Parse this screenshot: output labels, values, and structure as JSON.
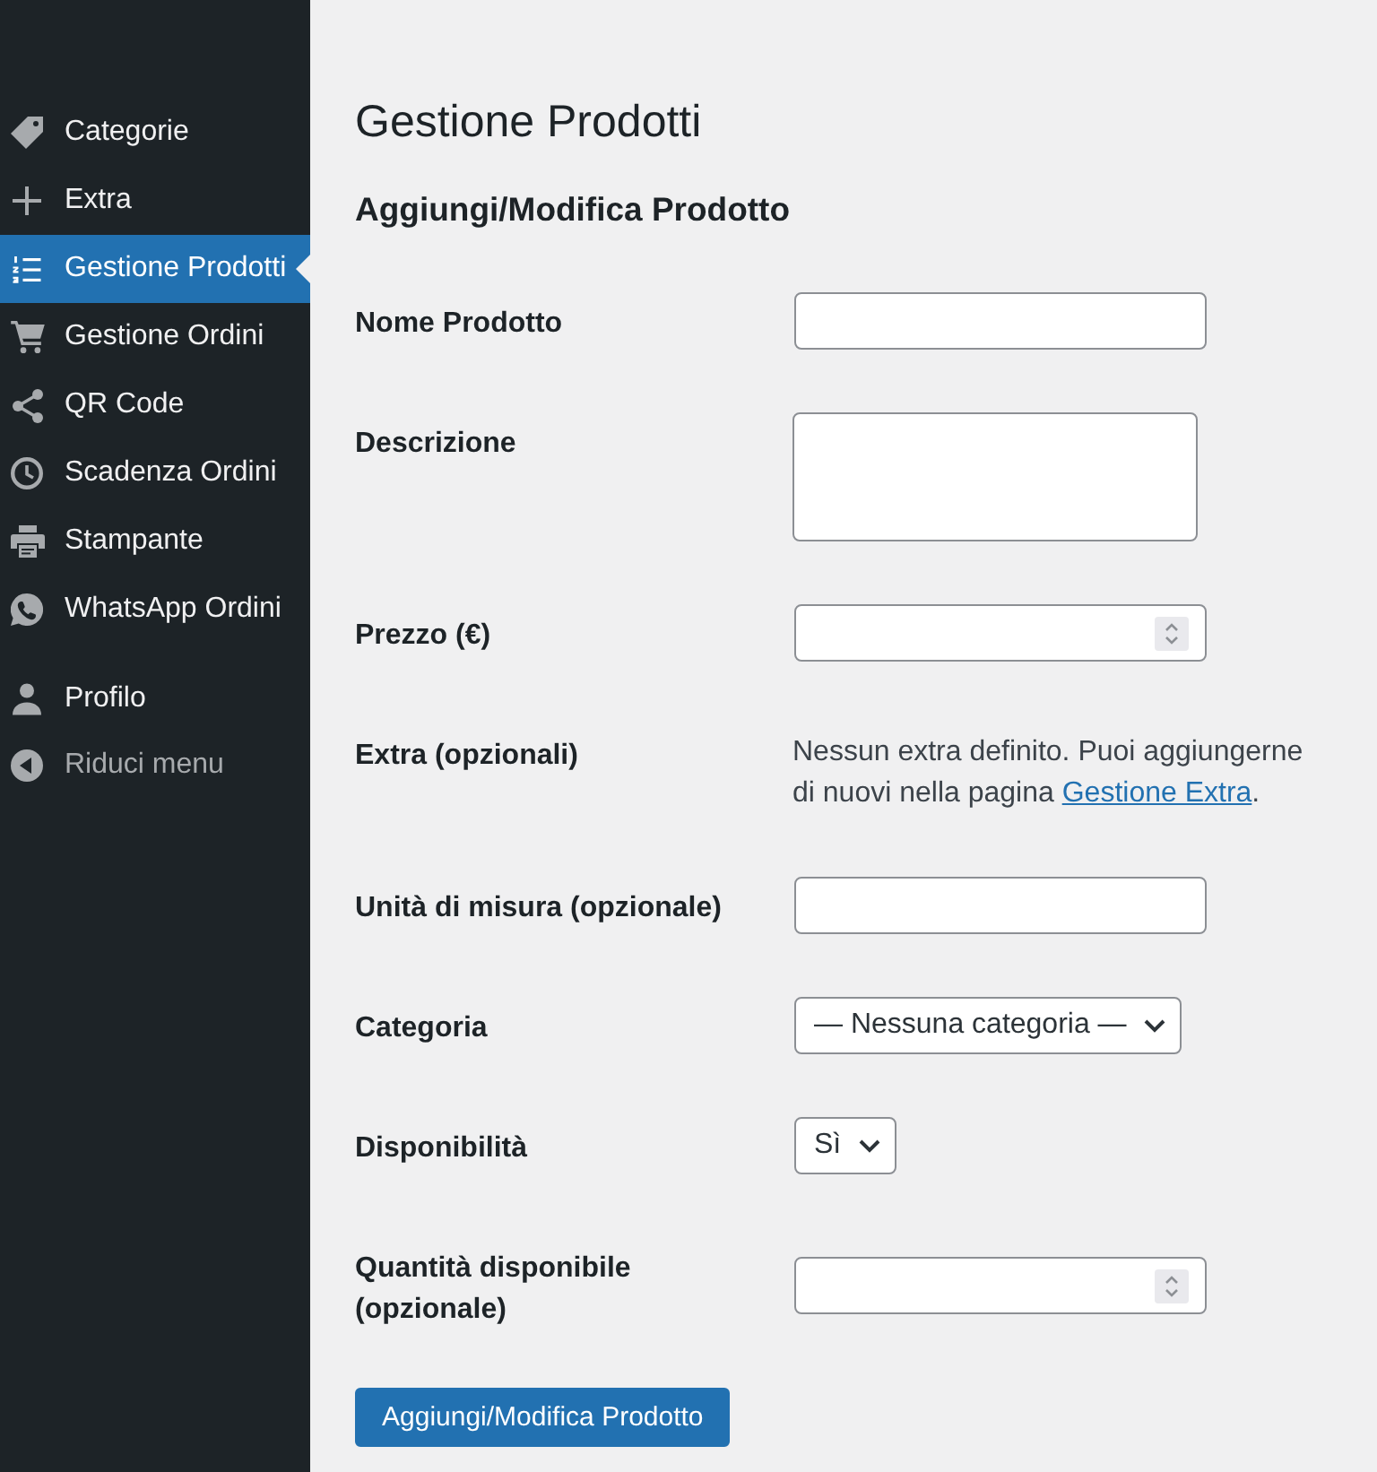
{
  "sidebar": {
    "items": [
      {
        "label": "Categorie",
        "selected": false
      },
      {
        "label": "Extra",
        "selected": false
      },
      {
        "label": "Gestione Prodotti",
        "selected": true
      },
      {
        "label": "Gestione Ordini",
        "selected": false
      },
      {
        "label": "QR Code",
        "selected": false
      },
      {
        "label": "Scadenza Ordini",
        "selected": false
      },
      {
        "label": "Stampante",
        "selected": false
      },
      {
        "label": "WhatsApp Ordini",
        "selected": false
      }
    ],
    "account_items": [
      {
        "label": "Profilo",
        "selected": false
      }
    ],
    "collapse_button": {
      "label": "Riduci menu"
    }
  },
  "page": {
    "title": "Gestione Prodotti",
    "section_title": "Aggiungi/Modifica Prodotto"
  },
  "form": {
    "fields": [
      {
        "kind": "text",
        "label": "Nome Prodotto"
      },
      {
        "kind": "textarea",
        "label": "Descrizione"
      },
      {
        "kind": "number",
        "label": "Prezzo (€)"
      },
      {
        "kind": "note",
        "label": "Extra (opzionali)",
        "text": "Nessun extra definito. Puoi aggiungerne di nuovi nella pagina ",
        "link": "Gestione Extra",
        "text_after": "."
      },
      {
        "kind": "text",
        "label": "Unità di misura (opzionale)"
      },
      {
        "kind": "select",
        "label": "Categoria",
        "value": "— Nessuna categoria —"
      },
      {
        "kind": "select",
        "label": "Disponibilità",
        "value": "Sì"
      },
      {
        "kind": "number",
        "label": "Quantità disponibile (opzionale)"
      }
    ],
    "submit_button": "Aggiungi/Modifica Prodotto"
  }
}
